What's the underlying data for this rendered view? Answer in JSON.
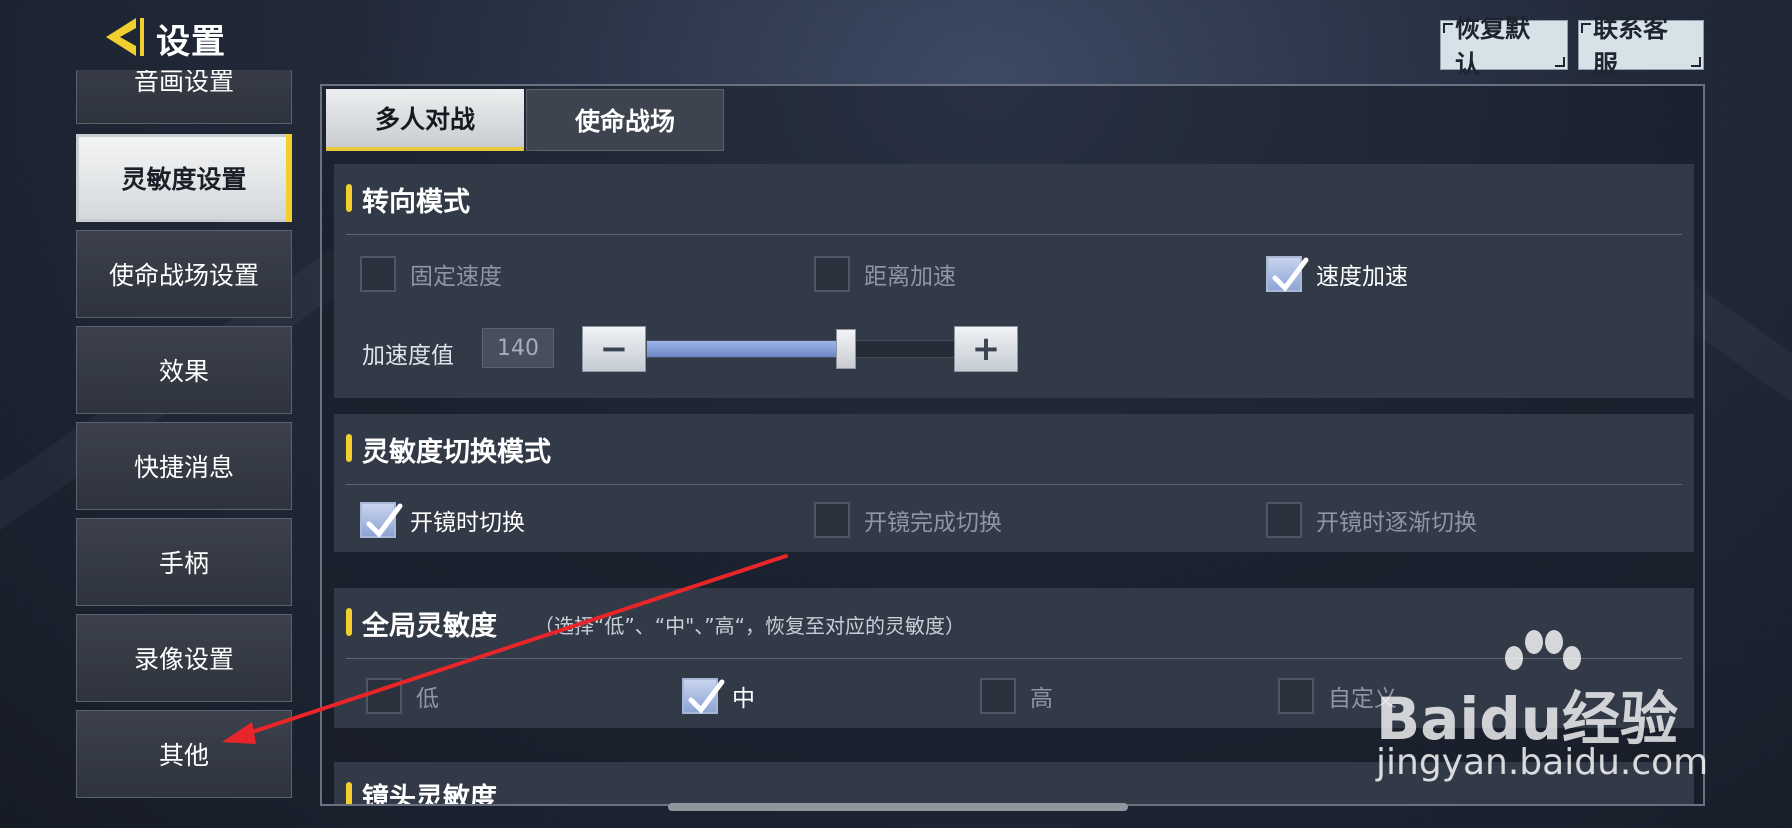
{
  "header": {
    "title": "设置",
    "back_icon": "back-arrow-icon",
    "buttons": [
      "恢复默认",
      "联系客服"
    ]
  },
  "sidebar": {
    "items": [
      {
        "label": "音画设置",
        "active": false
      },
      {
        "label": "灵敏度设置",
        "active": true
      },
      {
        "label": "使命战场设置",
        "active": false
      },
      {
        "label": "效果",
        "active": false
      },
      {
        "label": "快捷消息",
        "active": false
      },
      {
        "label": "手柄",
        "active": false
      },
      {
        "label": "录像设置",
        "active": false
      },
      {
        "label": "其他",
        "active": false
      }
    ]
  },
  "tabs": [
    {
      "label": "多人对战",
      "active": true
    },
    {
      "label": "使命战场",
      "active": false
    }
  ],
  "sections": {
    "turn_mode": {
      "title": "转向模式",
      "options": [
        {
          "label": "固定速度",
          "checked": false
        },
        {
          "label": "距离加速",
          "checked": false
        },
        {
          "label": "速度加速",
          "checked": true
        }
      ],
      "accel_label": "加速度值",
      "accel_value": "140",
      "accel_fraction": 0.63,
      "minus": "−",
      "plus": "+"
    },
    "switch_mode": {
      "title": "灵敏度切换模式",
      "options": [
        {
          "label": "开镜时切换",
          "checked": true
        },
        {
          "label": "开镜完成切换",
          "checked": false
        },
        {
          "label": "开镜时逐渐切换",
          "checked": false
        }
      ]
    },
    "global": {
      "title": "全局灵敏度",
      "note": "（选择“低”、“中\"、”高“，恢复至对应的灵敏度）",
      "options": [
        {
          "label": "低",
          "checked": false
        },
        {
          "label": "中",
          "checked": true
        },
        {
          "label": "高",
          "checked": false
        },
        {
          "label": "自定义",
          "checked": false
        }
      ]
    },
    "next_partial_title": "镜头灵敏度"
  },
  "watermark": {
    "brand": "Baidu经验",
    "url": "jingyan.baidu.com"
  },
  "colors": {
    "accent_yellow": "#f1cf2f",
    "check_blue": "#8ea4d6",
    "annotation_red": "#e8262a"
  }
}
